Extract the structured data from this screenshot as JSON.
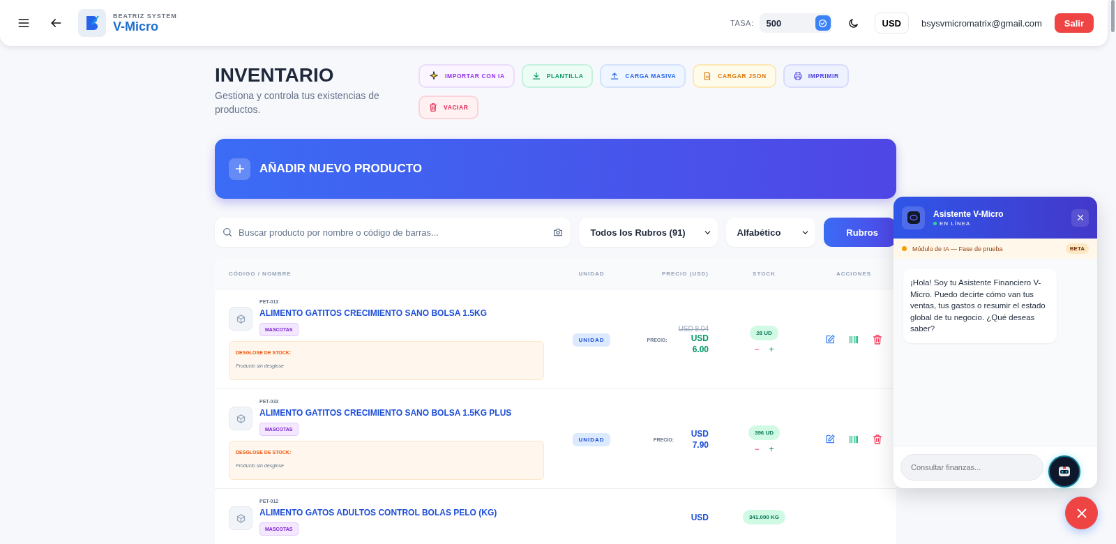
{
  "header": {
    "brand_subtitle": "BEATRIZ SYSTEM",
    "brand_title": "V-Micro",
    "rate_label": "TASA:",
    "rate_value": "500",
    "currency": "USD",
    "email": "bsysvmicromatrix@gmail.com",
    "logout": "Salir"
  },
  "page": {
    "title": "INVENTARIO",
    "subtitle": "Gestiona y controla tus existencias de productos."
  },
  "actions": [
    {
      "label": "IMPORTAR CON IA",
      "kind": "ai"
    },
    {
      "label": "PLANTILLA",
      "kind": "template"
    },
    {
      "label": "CARGA MASIVA",
      "kind": "upload"
    },
    {
      "label": "CARGAR JSON",
      "kind": "json"
    },
    {
      "label": "IMPRIMIR",
      "kind": "print"
    },
    {
      "label": "VACIAR",
      "kind": "clear"
    }
  ],
  "add_product": {
    "label": "AÑADIR NUEVO PRODUCTO"
  },
  "filters": {
    "search_placeholder": "Buscar producto por nombre o código de barras...",
    "category": "Todos los Rubros (91)",
    "sort": "Alfabético",
    "rubros_button": "Rubros"
  },
  "table": {
    "columns": [
      "CÓDIGO / NOMBRE",
      "UNIDAD",
      "PRECIO (USD)",
      "STOCK",
      "ACCIONES"
    ],
    "rows": [
      {
        "code": "PET-013",
        "name": "ALIMENTO GATITOS CRECIMIENTO SANO BOLSA 1.5KG",
        "tag": "MASCOTAS",
        "breakdown_title": "DESGLOSE DE STOCK:",
        "breakdown_text": "Producto sin desglose",
        "unit": "UNIDAD",
        "price_label": "PRECIO:",
        "old_price": "USD 8.04",
        "price": "USD 6.00",
        "on_sale": true,
        "stock": "28 UD",
        "minus": "−",
        "plus": "+"
      },
      {
        "code": "PET-033",
        "name": "ALIMENTO GATITOS CRECIMIENTO SANO BOLSA 1.5KG PLUS",
        "tag": "MASCOTAS",
        "breakdown_title": "DESGLOSE DE STOCK:",
        "breakdown_text": "Producto sin desglose",
        "unit": "UNIDAD",
        "price_label": "PRECIO:",
        "price": "USD 7.90",
        "on_sale": false,
        "stock": "396 UD",
        "minus": "−",
        "plus": "+"
      },
      {
        "code": "PET-012",
        "name": "ALIMENTO GATOS ADULTOS CONTROL BOLAS PELO (KG)",
        "tag": "MASCOTAS",
        "price": "USD",
        "on_sale": false,
        "stock": "341.000 KG"
      }
    ]
  },
  "chat": {
    "title": "Asistente V-Micro",
    "status": "EN LÍNEA",
    "notice": "Módulo de IA — Fase de prueba",
    "badge": "BETA",
    "message": "¡Hola! Soy tu Asistente Financiero V-Micro. Puedo decirte cómo van tus ventas, tus gastos o resumir el estado global de tu negocio. ¿Qué deseas saber?",
    "placeholder": "Consultar finanzas..."
  }
}
